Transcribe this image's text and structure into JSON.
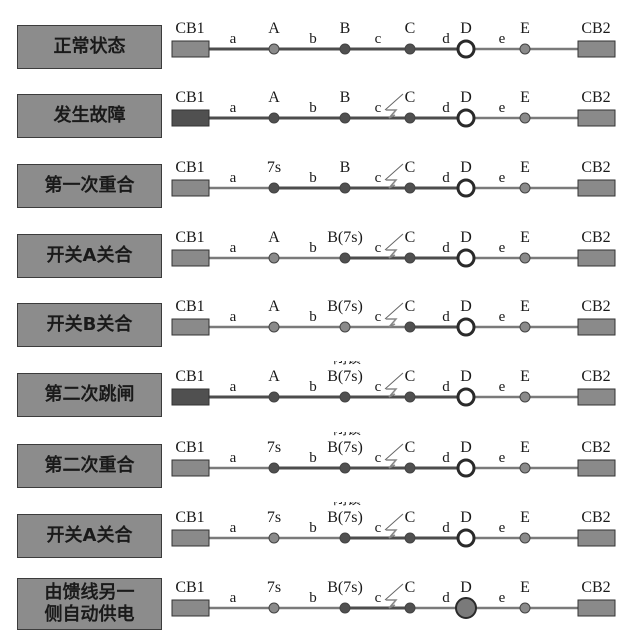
{
  "colors": {
    "line_normal": "#7a7a7a",
    "line_energized": "#4d4d4d",
    "breaker_open": "#8a8a8a",
    "breaker_closed": "#505050",
    "switch_open": "#8a8a8a",
    "switch_closed": "#505050",
    "box_fill": "#8c8c8c"
  },
  "labels": {
    "cb1": "CB1",
    "cb2": "CB2",
    "segments": [
      "a",
      "b",
      "c",
      "d",
      "e"
    ],
    "lock": "闭锁"
  },
  "rows": [
    {
      "state": "正常状态",
      "nodes": [
        "A",
        "B",
        "C",
        "D",
        "E"
      ],
      "fault": false,
      "lock": false,
      "cb1": "open",
      "switches": [
        "open",
        "closed",
        "closed",
        "ring",
        "open"
      ],
      "energized": [
        "a",
        "b",
        "c",
        "d"
      ]
    },
    {
      "state": "发生故障",
      "nodes": [
        "A",
        "B",
        "C",
        "D",
        "E"
      ],
      "fault": true,
      "lock": false,
      "cb1": "closed",
      "switches": [
        "closed",
        "closed",
        "closed",
        "ring",
        "open"
      ],
      "energized": [
        "a",
        "b",
        "c",
        "d"
      ]
    },
    {
      "state": "第一次重合",
      "nodes": [
        "7s",
        "B",
        "C",
        "D",
        "E"
      ],
      "fault": true,
      "lock": false,
      "cb1": "open",
      "switches": [
        "closed",
        "closed",
        "closed",
        "ring",
        "open"
      ],
      "energized": [
        "b",
        "c",
        "d"
      ]
    },
    {
      "state": "开关A关合",
      "nodes": [
        "A",
        "B(7s)",
        "C",
        "D",
        "E"
      ],
      "fault": true,
      "lock": false,
      "cb1": "open",
      "switches": [
        "open",
        "closed",
        "closed",
        "ring",
        "open"
      ],
      "energized": [
        "c",
        "d"
      ]
    },
    {
      "state": "开关B关合",
      "nodes": [
        "A",
        "B(7s)",
        "C",
        "D",
        "E"
      ],
      "fault": true,
      "lock": false,
      "cb1": "open",
      "switches": [
        "open",
        "open",
        "closed",
        "ring",
        "open"
      ],
      "energized": [
        "d"
      ]
    },
    {
      "state": "第二次跳闸",
      "nodes": [
        "A",
        "B(7s)",
        "C",
        "D",
        "E"
      ],
      "fault": true,
      "lock": true,
      "cb1": "closed",
      "switches": [
        "closed",
        "closed",
        "closed",
        "ring",
        "open"
      ],
      "energized": [
        "a",
        "b",
        "c",
        "d"
      ]
    },
    {
      "state": "第二次重合",
      "nodes": [
        "7s",
        "B(7s)",
        "C",
        "D",
        "E"
      ],
      "fault": true,
      "lock": true,
      "cb1": "open",
      "switches": [
        "closed",
        "closed",
        "closed",
        "ring",
        "open"
      ],
      "energized": [
        "b",
        "c",
        "d"
      ]
    },
    {
      "state": "开关A关合",
      "nodes": [
        "7s",
        "B(7s)",
        "C",
        "D",
        "E"
      ],
      "fault": true,
      "lock": true,
      "cb1": "open",
      "switches": [
        "open",
        "closed",
        "closed",
        "ring",
        "open"
      ],
      "energized": [
        "c",
        "d"
      ]
    },
    {
      "state": "由馈线另一\n侧自动供电",
      "nodes": [
        "7s",
        "B(7s)",
        "C",
        "D",
        "E"
      ],
      "fault": true,
      "lock": false,
      "cb1": "open",
      "switches": [
        "open",
        "closed",
        "closed",
        "filled",
        "open"
      ],
      "energized": [
        "c"
      ]
    }
  ]
}
